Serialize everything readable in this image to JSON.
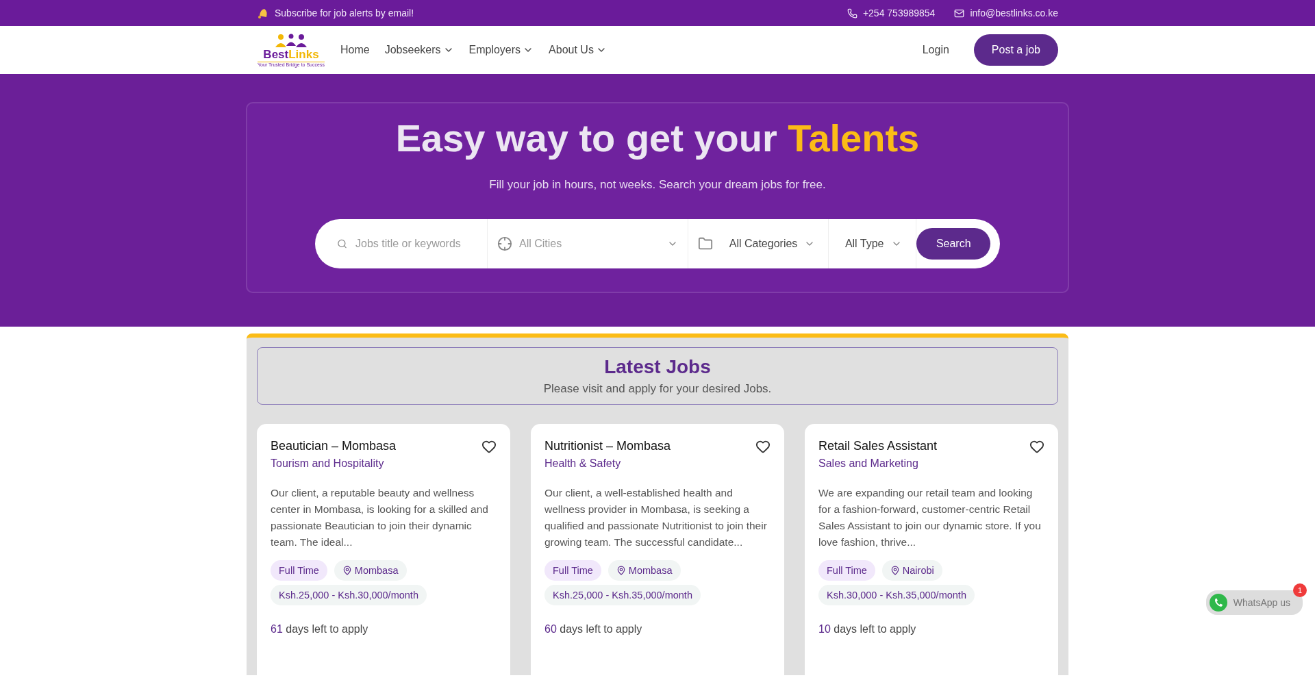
{
  "topbar": {
    "subscribe": "Subscribe for job alerts by email!",
    "phone": "+254 753989854",
    "email": "info@bestlinks.co.ke"
  },
  "nav": {
    "logo": {
      "name_a": "Best",
      "name_b": "Links",
      "tagline": "Your Trusted Bridge to Success"
    },
    "links": [
      {
        "label": "Home",
        "dropdown": false
      },
      {
        "label": "Jobseekers",
        "dropdown": true
      },
      {
        "label": "Employers",
        "dropdown": true
      },
      {
        "label": "About Us",
        "dropdown": true
      }
    ],
    "login": "Login",
    "post": "Post a job"
  },
  "hero": {
    "title": "Easy way to get your",
    "title_highlight": "Talents",
    "subtitle": "Fill your job in hours, not weeks. Search your dream jobs for free.",
    "search": {
      "keywords_placeholder": "Jobs title or keywords",
      "city": "All Cities",
      "category": "All Categories",
      "type": "All Type",
      "button": "Search"
    }
  },
  "latest": {
    "title": "Latest Jobs",
    "subtitle": "Please visit and apply for your desired Jobs.",
    "jobs": [
      {
        "title": "Beautician – Mombasa",
        "category": "Tourism and Hospitality",
        "description": "Our client, a reputable beauty and wellness center in Mombasa, is looking for a skilled and passionate Beautician to join their dynamic team. The ideal...",
        "type": "Full Time",
        "location": "Mombasa",
        "salary": "Ksh.25,000 - Ksh.30,000/month",
        "days": "61",
        "days_text": "days left to apply",
        "saved": false
      },
      {
        "title": "Nutritionist – Mombasa",
        "category": "Health & Safety",
        "description": "Our client, a well-established health and wellness provider in Mombasa, is seeking a qualified and passionate Nutritionist to join their growing team. The successful candidate...",
        "type": "Full Time",
        "location": "Mombasa",
        "salary": "Ksh.25,000 - Ksh.35,000/month",
        "days": "60",
        "days_text": "days left to apply",
        "saved": false
      },
      {
        "title": "Retail Sales Assistant",
        "category": "Sales and Marketing",
        "description": "We are expanding our retail team and looking for a fashion-forward, customer-centric Retail Sales Assistant to join our dynamic store. If you love fashion, thrive...",
        "type": "Full Time",
        "location": "Nairobi",
        "salary": "Ksh.30,000 - Ksh.35,000/month",
        "days": "10",
        "days_text": "days left to apply",
        "saved": false
      }
    ]
  },
  "whatsapp": {
    "label": "WhatsApp us",
    "badge": "1"
  }
}
